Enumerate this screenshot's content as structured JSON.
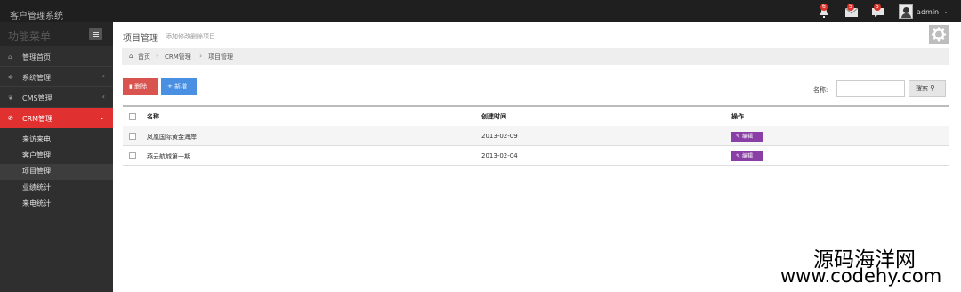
{
  "header": {
    "brand": "客户管理系统",
    "notifications": [
      {
        "icon": "bell-icon",
        "count": "6"
      },
      {
        "icon": "mail-icon",
        "count": "5"
      },
      {
        "icon": "chat-icon",
        "count": "5"
      }
    ],
    "user": "admin"
  },
  "sidebar": {
    "title": "功能菜单",
    "items": [
      {
        "label": "管理首页",
        "icon": "home-icon",
        "caret": ""
      },
      {
        "label": "系统管理",
        "icon": "gear-icon",
        "caret": "‹"
      },
      {
        "label": "CMS管理",
        "icon": "leaf-icon",
        "caret": "‹"
      },
      {
        "label": "CRM管理",
        "icon": "phone-icon",
        "caret": "⌄"
      }
    ],
    "submenu": [
      "来访来电",
      "客户管理",
      "项目管理",
      "业绩统计",
      "来电统计"
    ]
  },
  "page": {
    "title": "项目管理",
    "subtitle": "添加修改删除项目",
    "breadcrumb": [
      "首页",
      "CRM管理",
      "项目管理"
    ]
  },
  "toolbar": {
    "delete_label": "删除",
    "add_label": "新增",
    "search_label": "名称:",
    "search_value": "",
    "search_button": "搜索"
  },
  "table": {
    "headers": [
      "名称",
      "创建时间",
      "操作"
    ],
    "rows": [
      {
        "name": "凤凰国际黄金海岸",
        "date": "2013-02-09",
        "action": "编辑"
      },
      {
        "name": "燕云航城第一期",
        "date": "2013-02-04",
        "action": "编辑"
      }
    ]
  },
  "watermark": {
    "line1": "源码海洋网",
    "line2": "www.codehy.com"
  },
  "colors": {
    "accent_red": "#e0302f",
    "button_blue": "#4a90e2",
    "edit_purple": "#8a3fa6",
    "sidebar": "#2f2f2f"
  }
}
